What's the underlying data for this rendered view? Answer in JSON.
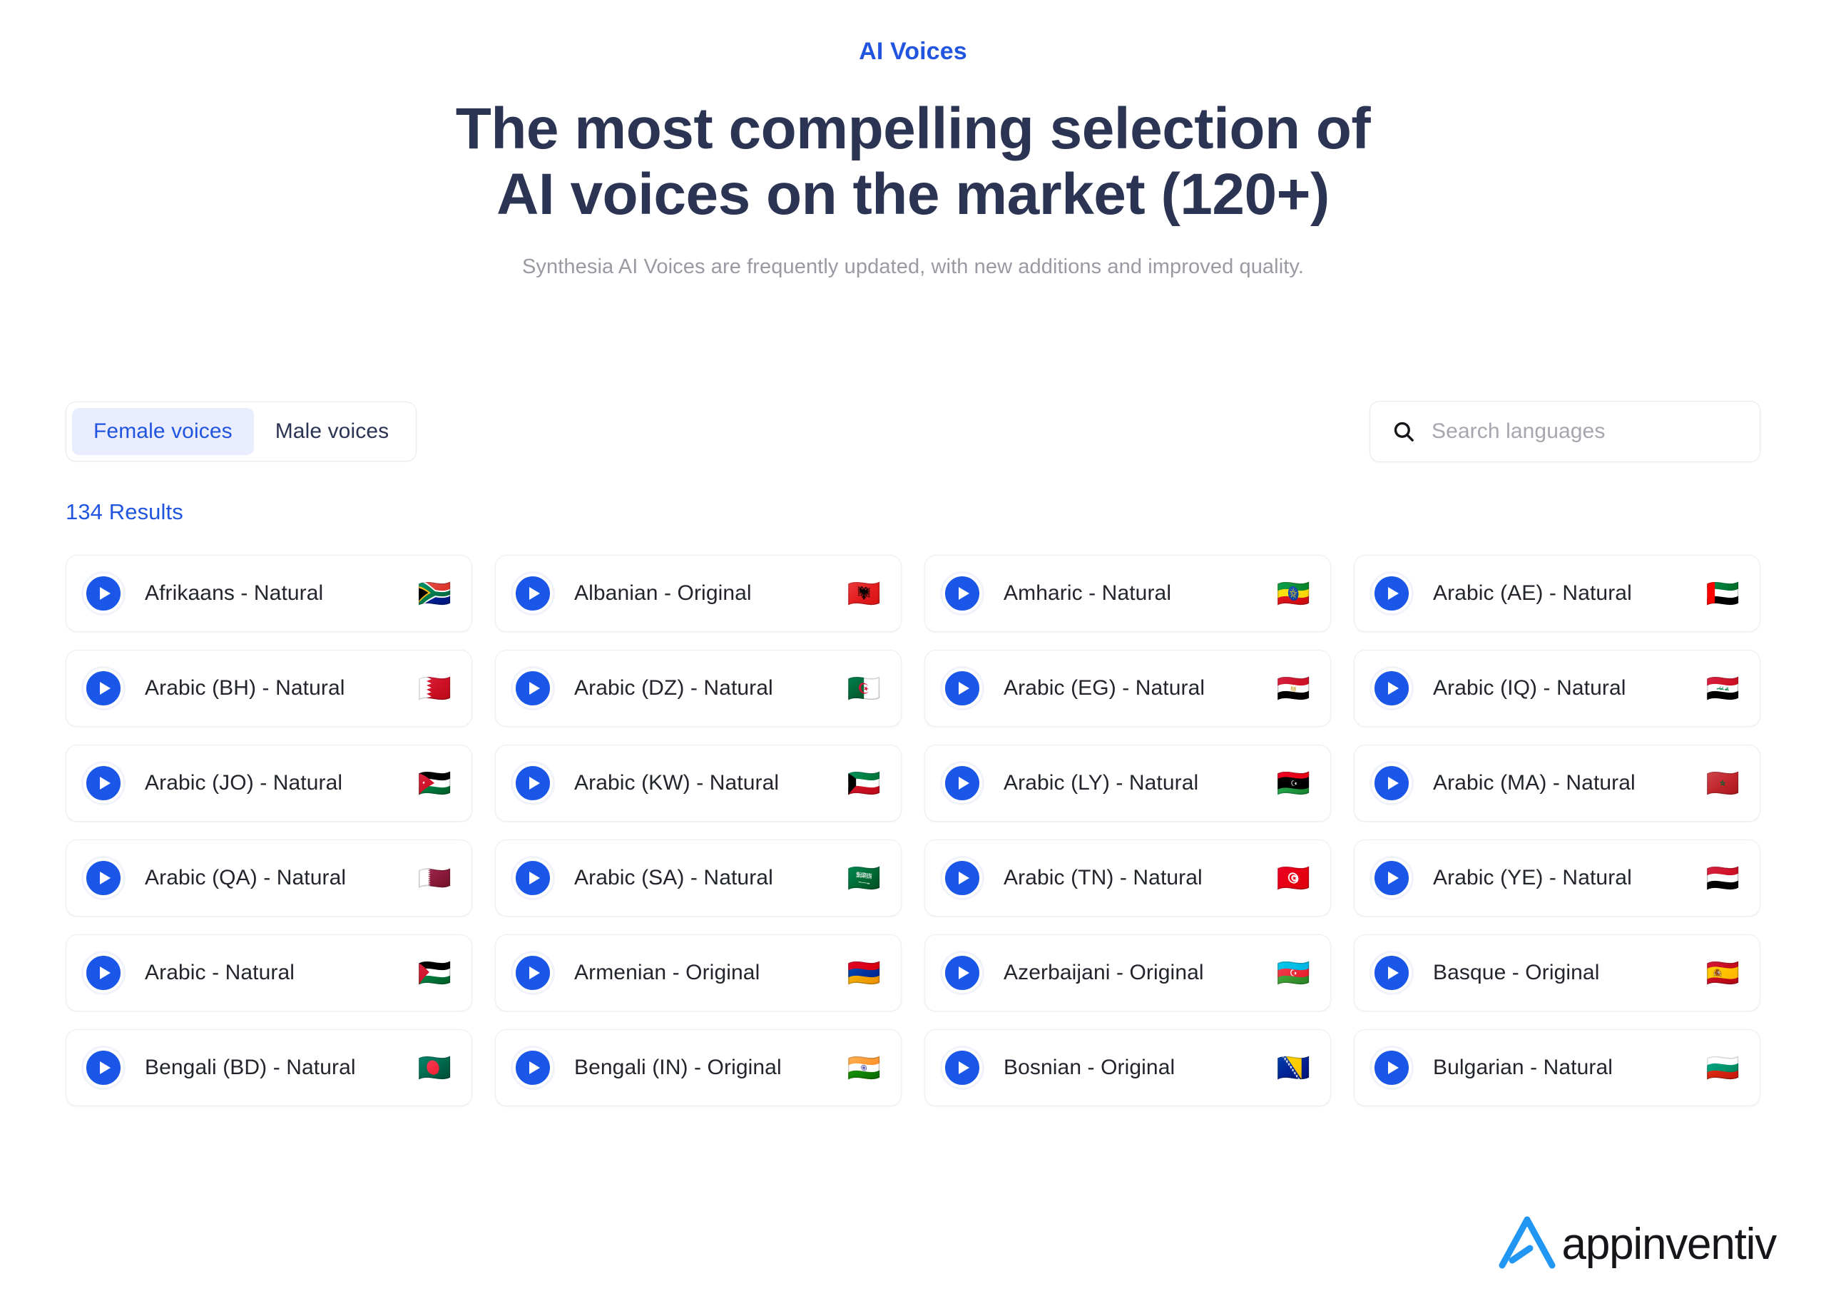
{
  "hero": {
    "eyebrow": "AI Voices",
    "headline_line1": "The most compelling selection of",
    "headline_line2": "AI voices on the market (120+)",
    "subhead": "Synthesia AI Voices are frequently updated, with new additions and improved quality."
  },
  "controls": {
    "tabs": [
      {
        "label": "Female voices",
        "active": true
      },
      {
        "label": "Male voices",
        "active": false
      }
    ],
    "search": {
      "icon": "search-icon",
      "placeholder": "Search languages",
      "value": ""
    }
  },
  "results": {
    "count_label": "134 Results"
  },
  "colors": {
    "accent_blue": "#2155e0",
    "play_blue": "#1a56e8",
    "headline_navy": "#2b3452",
    "subhead_grey": "#9a9aa2",
    "tab_active_bg": "#e9edfd",
    "card_border": "#ededf2",
    "logo_blue": "#2196f3"
  },
  "voices": [
    {
      "label": "Afrikaans - Natural",
      "flag": "🇿🇦",
      "play": "play-icon"
    },
    {
      "label": "Albanian - Original",
      "flag": "🇦🇱",
      "play": "play-icon"
    },
    {
      "label": "Amharic - Natural",
      "flag": "🇪🇹",
      "play": "play-icon"
    },
    {
      "label": "Arabic (AE) - Natural",
      "flag": "🇦🇪",
      "play": "play-icon"
    },
    {
      "label": "Arabic (BH) - Natural",
      "flag": "🇧🇭",
      "play": "play-icon"
    },
    {
      "label": "Arabic (DZ) - Natural",
      "flag": "🇩🇿",
      "play": "play-icon"
    },
    {
      "label": "Arabic (EG) - Natural",
      "flag": "🇪🇬",
      "play": "play-icon"
    },
    {
      "label": "Arabic (IQ) - Natural",
      "flag": "🇮🇶",
      "play": "play-icon"
    },
    {
      "label": "Arabic (JO) - Natural",
      "flag": "🇯🇴",
      "play": "play-icon"
    },
    {
      "label": "Arabic (KW) - Natural",
      "flag": "🇰🇼",
      "play": "play-icon"
    },
    {
      "label": "Arabic (LY) - Natural",
      "flag": "🇱🇾",
      "play": "play-icon"
    },
    {
      "label": "Arabic (MA) - Natural",
      "flag": "🇲🇦",
      "play": "play-icon"
    },
    {
      "label": "Arabic (QA) - Natural",
      "flag": "🇶🇦",
      "play": "play-icon"
    },
    {
      "label": "Arabic (SA) - Natural",
      "flag": "🇸🇦",
      "play": "play-icon"
    },
    {
      "label": "Arabic (TN) - Natural",
      "flag": "🇹🇳",
      "play": "play-icon"
    },
    {
      "label": "Arabic (YE) - Natural",
      "flag": "🇾🇪",
      "play": "play-icon"
    },
    {
      "label": "Arabic - Natural",
      "flag": "🇵🇸",
      "play": "play-icon"
    },
    {
      "label": "Armenian - Original",
      "flag": "🇦🇲",
      "play": "play-icon"
    },
    {
      "label": "Azerbaijani - Original",
      "flag": "🇦🇿",
      "play": "play-icon"
    },
    {
      "label": "Basque - Original",
      "flag": "🇪🇸",
      "play": "play-icon"
    },
    {
      "label": "Bengali (BD) - Natural",
      "flag": "🇧🇩",
      "play": "play-icon"
    },
    {
      "label": "Bengali (IN) - Original",
      "flag": "🇮🇳",
      "play": "play-icon"
    },
    {
      "label": "Bosnian - Original",
      "flag": "🇧🇦",
      "play": "play-icon"
    },
    {
      "label": "Bulgarian - Natural",
      "flag": "🇧🇬",
      "play": "play-icon"
    }
  ],
  "logo": {
    "text": "appinventiv",
    "mark": "appinventiv-a-mark-icon"
  }
}
